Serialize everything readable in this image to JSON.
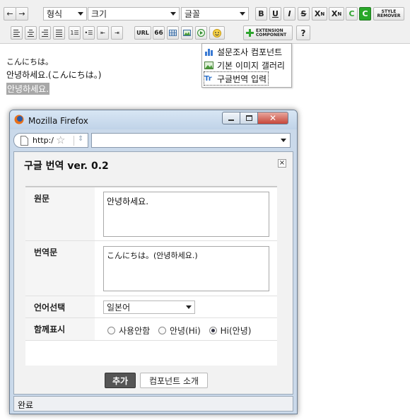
{
  "toolbar": {
    "undo": "←",
    "redo": "→",
    "format_select": "형식",
    "size_select": "크기",
    "font_select": "글꼴",
    "bold": "B",
    "underline": "U",
    "italic": "I",
    "strike": "S",
    "superscript": "X",
    "superscript_mark": "N",
    "subscript": "X",
    "subscript_mark": "N",
    "font_color": "C",
    "bg_color": "C",
    "style_remover_1": "STYLE",
    "style_remover_2": "REMOVER",
    "url": "URL",
    "quote": "66",
    "ext_component_1": "EXTENSION",
    "ext_component_2": "COMPONENT",
    "help": "?"
  },
  "editor": {
    "line1": "こんにちは。",
    "line2": "안녕하세요.(こんにちは。)",
    "line3": "안녕하세요."
  },
  "dropdown": {
    "items": [
      {
        "label": "설문조사 컴포넌트"
      },
      {
        "label": "기본 이미지 갤러리"
      },
      {
        "label": "구글번역 입력",
        "icon": "Tr"
      }
    ]
  },
  "browser": {
    "title": "Mozilla Firefox",
    "url_prefix": "http:/",
    "url_value": "",
    "status": "완료"
  },
  "dialog": {
    "title": "구글 번역 ver. 0.2",
    "close": "×",
    "source_label": "원문",
    "source_value": "안녕하세요.",
    "translation_label": "번역문",
    "translation_value": "こんにちは。(안녕하세요.)",
    "language_label": "언어선택",
    "language_value": "일본어",
    "display_label": "함께표시",
    "display_options": [
      "사용안함",
      "안녕(Hi)",
      "Hi(안녕)"
    ],
    "display_selected": 2,
    "add_button": "추가",
    "about_button": "컴포넌트 소개"
  },
  "colors": {
    "green_c": "#2ea32e",
    "green_c_bg": "#29a829",
    "window_chrome": "#cad9ea",
    "close_red": "#d1473a"
  }
}
